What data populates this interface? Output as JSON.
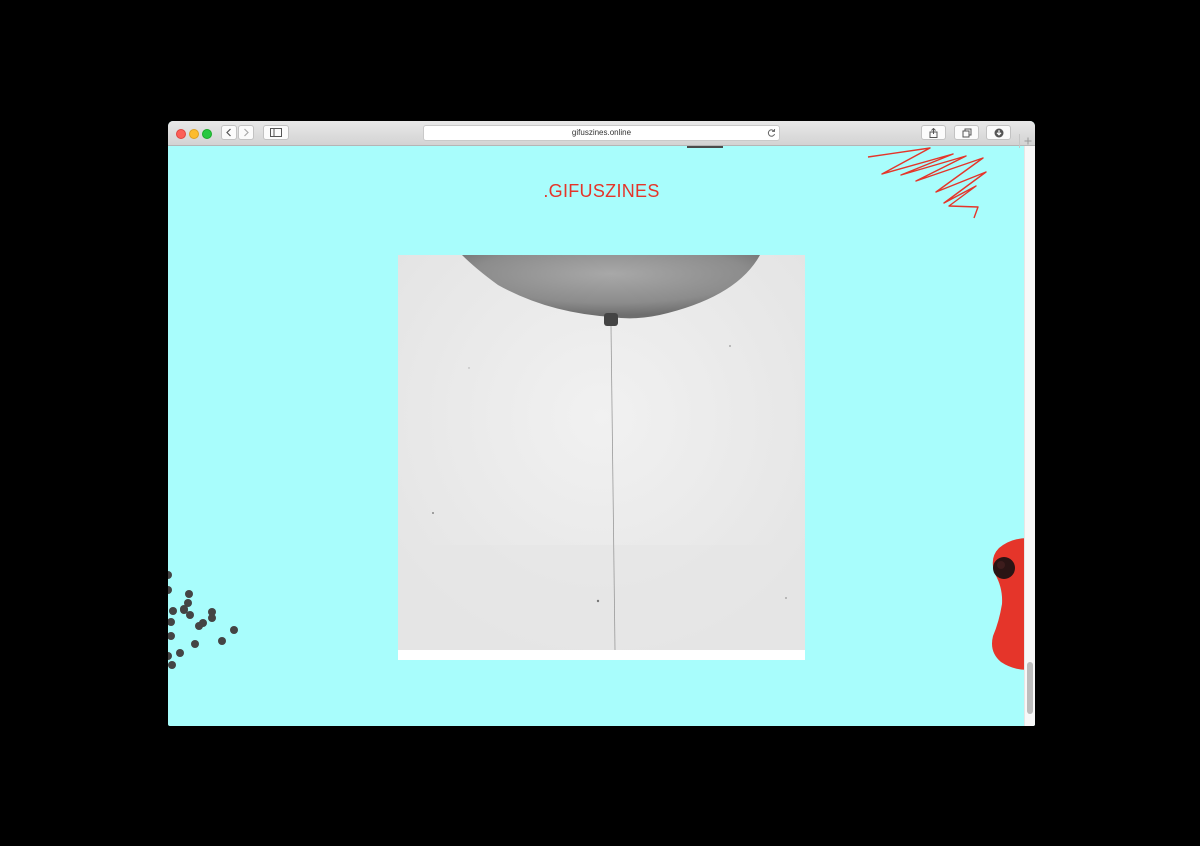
{
  "browser": {
    "url": "gifuszines.online",
    "icons": {
      "back": "chevron-left-icon",
      "forward": "chevron-right-icon",
      "sidebar": "sidebar-icon",
      "reload": "reload-icon",
      "share": "share-icon",
      "tabs": "tab-overview-icon",
      "downloads": "downloads-icon",
      "new_tab": "plus-icon"
    }
  },
  "page": {
    "title": ".GIFUSZINES",
    "background_color": "#a8fdfc",
    "accent_color": "#e5352a",
    "gif": {
      "subject": "balloon-with-string"
    }
  },
  "scrollbar": {
    "scroll_fraction": 0.98
  }
}
